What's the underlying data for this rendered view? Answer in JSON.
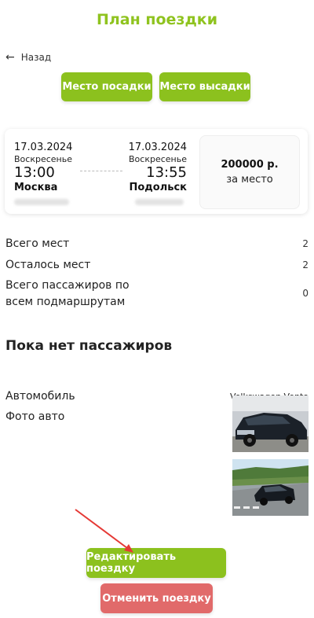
{
  "header": {
    "title": "План поездки",
    "back_label": "Назад"
  },
  "actions": {
    "pickup_label": "Место посадки",
    "dropoff_label": "Место высадки"
  },
  "trip": {
    "departure": {
      "date": "17.03.2024",
      "weekday": "Воскресенье",
      "time": "13:00",
      "city": "Москва"
    },
    "arrival": {
      "date": "17.03.2024",
      "weekday": "Воскресенье",
      "time": "13:55",
      "city": "Подольск"
    },
    "price": "200000 р.",
    "price_unit": "за место"
  },
  "stats": [
    {
      "label": "Всего мест",
      "value": "2"
    },
    {
      "label": "Осталось мест",
      "value": "2"
    },
    {
      "label": "Всего пассажиров по всем подмаршрутам",
      "value": "0"
    }
  ],
  "passengers": {
    "empty_title": "Пока нет пассажиров"
  },
  "car": {
    "label": "Автомобиль",
    "value": "Volkswagen Vento",
    "photo_label": "Фото авто"
  },
  "footer": {
    "edit_label": "Редактировать поездку",
    "cancel_label": "Отменить поездку"
  },
  "colors": {
    "accent": "#8cc11e",
    "title": "#8fc31f",
    "danger": "#e16a6a",
    "annotation": "#e53935"
  },
  "icons": {
    "back": "arrow-left-icon"
  }
}
